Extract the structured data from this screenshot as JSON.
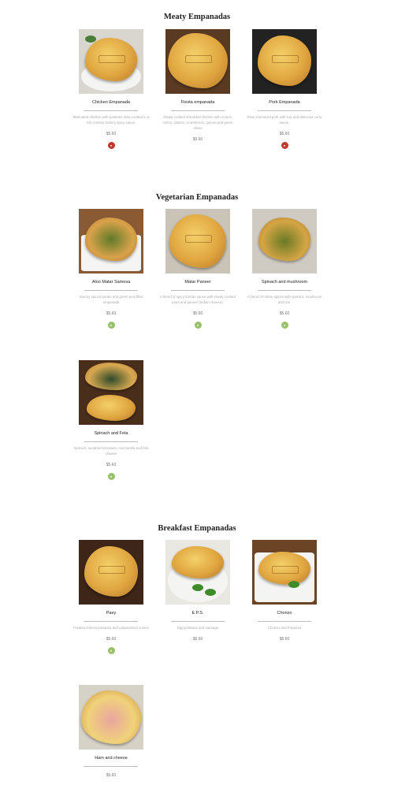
{
  "sections": [
    {
      "title": "Meaty Empanadas",
      "items": [
        {
          "name": "Chicken Empanada",
          "desc": "Marinated chicken with potatoes slow cooked in a rich creamy buttery spicy sauce.",
          "price": "$5.60",
          "badge": "meat",
          "badge_icon": "chili-pepper-icon"
        },
        {
          "name": "Fiesta empanada",
          "desc": "Slowly cooked shredded chicken with onions, celery, cilantro, cranberries, quinoa and green olives",
          "price": "$5.60",
          "badge": "",
          "badge_icon": ""
        },
        {
          "name": "Pork Empanada",
          "desc": "Slow simmered pork with soy and delicious curry sauce.",
          "price": "$5.60",
          "badge": "meat",
          "badge_icon": "chili-pepper-icon"
        }
      ]
    },
    {
      "title": "Vegetarian Empanadas",
      "items": [
        {
          "name": "Aloo Matar Samosa",
          "desc": "Savory spiced potato and green pea filled empanada",
          "price": "$5.60",
          "badge": "veg",
          "badge_icon": "vegetarian-icon"
        },
        {
          "name": "Matar Paneer",
          "desc": "A blend of spicy tomato sauce with slowly cooked peas and paneer (Indian cheese).",
          "price": "$5.60",
          "badge": "veg",
          "badge_icon": "vegetarian-icon"
        },
        {
          "name": "Spinach and mushroom",
          "desc": "A blend of Indian spices with spinach, mushroom and rice.",
          "price": "$5.60",
          "badge": "veg",
          "badge_icon": "vegetarian-icon"
        },
        {
          "name": "Spinach and Feta",
          "desc": "Spinach, sundried tomatoes, mozzarella and feta cheese",
          "price": "$5.60",
          "badge": "veg",
          "badge_icon": "vegetarian-icon"
        }
      ]
    },
    {
      "title": "Breakfast Empanadas",
      "items": [
        {
          "name": "Paey",
          "desc": "Fontina cheese,potatoes and caramelized onions",
          "price": "$5.60",
          "badge": "veg",
          "badge_icon": "vegetarian-icon"
        },
        {
          "name": "E.P.S.",
          "desc": "Egg potatoes and sausage",
          "price": "$5.60",
          "badge": "",
          "badge_icon": ""
        },
        {
          "name": "Chorizo",
          "desc": "Chorizo and Potatoes",
          "price": "$5.60",
          "badge": "",
          "badge_icon": ""
        },
        {
          "name": "Ham and cheese",
          "desc": "",
          "price": "$5.60",
          "badge": "",
          "badge_icon": ""
        }
      ]
    }
  ],
  "colors": {
    "meat_badge": "#c0392b",
    "veg_badge": "#9bc06a",
    "divider": "#bbbbbb"
  }
}
